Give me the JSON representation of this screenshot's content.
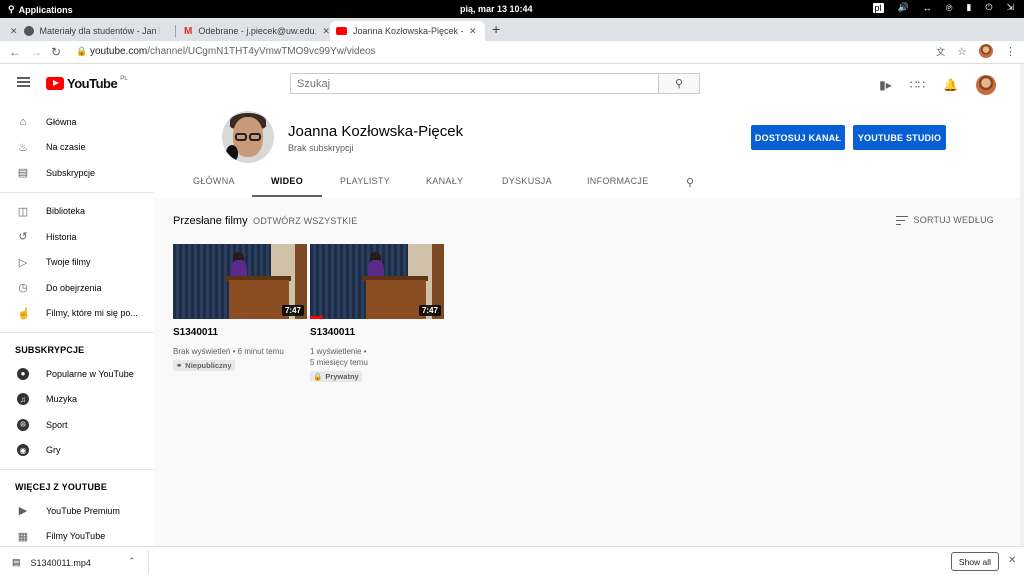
{
  "os_bar": {
    "applications": "Applications",
    "clock": "pią, mar 13   10:44",
    "keyboard": "pl"
  },
  "tabs": [
    {
      "title": "Materiały dla studentów - Jan K",
      "icon": "globe-icon"
    },
    {
      "title": "Odebrane - j.piecek@uw.edu.pl",
      "icon": "gmail-icon"
    },
    {
      "title": "Joanna Kozłowska-Pięcek - YouT",
      "icon": "youtube-icon"
    }
  ],
  "address": {
    "host": "youtube.com",
    "path": "/channel/UCgmN1THT4yVmwTMO9vc99Yw/videos"
  },
  "search": {
    "placeholder": "Szukaj"
  },
  "sidebar": {
    "main": [
      {
        "label": "Główna",
        "icon": "home-icon"
      },
      {
        "label": "Na czasie",
        "icon": "flame-icon"
      },
      {
        "label": "Subskrypcje",
        "icon": "subscriptions-icon"
      }
    ],
    "library": [
      {
        "label": "Biblioteka",
        "icon": "library-icon"
      },
      {
        "label": "Historia",
        "icon": "history-icon"
      },
      {
        "label": "Twoje filmy",
        "icon": "play-box-icon"
      },
      {
        "label": "Do obejrzenia",
        "icon": "clock-icon"
      },
      {
        "label": "Filmy, które mi się po...",
        "icon": "thumbs-up-icon"
      }
    ],
    "subs_heading": "SUBSKRYPCJE",
    "subs": [
      {
        "label": "Popularne w YouTube"
      },
      {
        "label": "Muzyka"
      },
      {
        "label": "Sport"
      },
      {
        "label": "Gry"
      }
    ],
    "more_heading": "WIĘCEJ Z YOUTUBE",
    "more": [
      {
        "label": "YouTube Premium"
      },
      {
        "label": "Filmy YouTube"
      }
    ]
  },
  "channel": {
    "name": "Joanna Kozłowska-Pięcek",
    "subscribers": "Brak subskrypcji",
    "customize_btn": "DOSTOSUJ KANAŁ",
    "studio_btn": "YOUTUBE STUDIO",
    "tabs": [
      "GŁÓWNA",
      "WIDEO",
      "PLAYLISTY",
      "KANAŁY",
      "DYSKUSJA",
      "INFORMACJE"
    ],
    "active_tab": "WIDEO"
  },
  "uploads": {
    "title": "Przesłane filmy",
    "play_all": "ODTWÓRZ WSZYSTKIE",
    "sort": "SORTUJ WEDŁUG",
    "videos": [
      {
        "title": "S1340011",
        "duration": "7:47",
        "meta1": "Brak wyświetleń • 6 minut temu",
        "meta2": "",
        "badge": "Niepubliczny",
        "badge_icon": "link-icon",
        "watched": 0
      },
      {
        "title": "S1340011",
        "duration": "7:47",
        "meta1": "1 wyświetlenie •",
        "meta2": "5 miesięcy temu",
        "badge": "Prywatny",
        "badge_icon": "lock-icon",
        "watched": 0.1
      }
    ]
  },
  "download": {
    "file": "S1340011.mp4",
    "show_all": "Show all"
  },
  "colors": {
    "youtube_red": "#ff0000",
    "blue_button": "#065fd4"
  }
}
